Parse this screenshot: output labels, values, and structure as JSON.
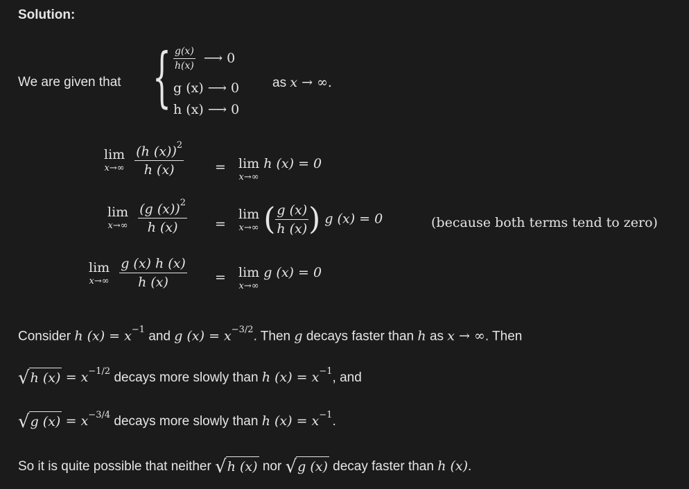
{
  "heading": "Solution:",
  "given": {
    "prefix": "We are given that",
    "line1_num": "g(x)",
    "line1_den": "h(x)",
    "line1_tail": "⟶ 0",
    "line2": "g (x) ⟶ 0",
    "line3": "h (x) ⟶ 0",
    "suffix_text": "as",
    "suffix_math": "x → ∞."
  },
  "eq1": {
    "lim": "lim",
    "sub": "x→∞",
    "num": "(h (x))",
    "num_exp": "2",
    "den": "h (x)",
    "eq": "=",
    "rhs": "h (x) = 0"
  },
  "eq2": {
    "lim": "lim",
    "sub": "x→∞",
    "num": "(g (x))",
    "num_exp": "2",
    "den": "h (x)",
    "eq": "=",
    "rhs_num": "g (x)",
    "rhs_den": "h (x)",
    "rhs_tail": "g (x) = 0",
    "note": "(because both terms tend to zero)"
  },
  "eq3": {
    "lim": "lim",
    "sub": "x→∞",
    "num": "g (x) h (x)",
    "den": "h (x)",
    "eq": "=",
    "rhs": "g (x) = 0"
  },
  "line4": {
    "t1": "Consider",
    "m1": "h (x) = x",
    "m1_exp": "−1",
    "t2": "and",
    "m2": "g (x) = x",
    "m2_exp": "−3/2",
    "t3": ". Then",
    "m3": "g",
    "t4": "decays faster than",
    "m4": "h",
    "t5": "as",
    "m5": "x → ∞",
    "t6": ". Then"
  },
  "line5": {
    "rad": "h (x)",
    "m1": "= x",
    "m1_exp": "−1/2",
    "t1": "decays more slowly than",
    "m2": "h (x) = x",
    "m2_exp": "−1",
    "t2": ", and"
  },
  "line6": {
    "rad": "g (x)",
    "m1": "= x",
    "m1_exp": "−3/4",
    "t1": "decays more slowly than",
    "m2": "h (x) = x",
    "m2_exp": "−1",
    "t2": "."
  },
  "line7": {
    "t1": "So it is quite possible that neither",
    "rad1": "h (x)",
    "t2": "nor",
    "rad2": "g (x)",
    "t3": "decay faster than",
    "m1": "h (x)",
    "t4": "."
  },
  "colors": {
    "background": "#1b1b1b",
    "text": "#e6e6e6"
  }
}
